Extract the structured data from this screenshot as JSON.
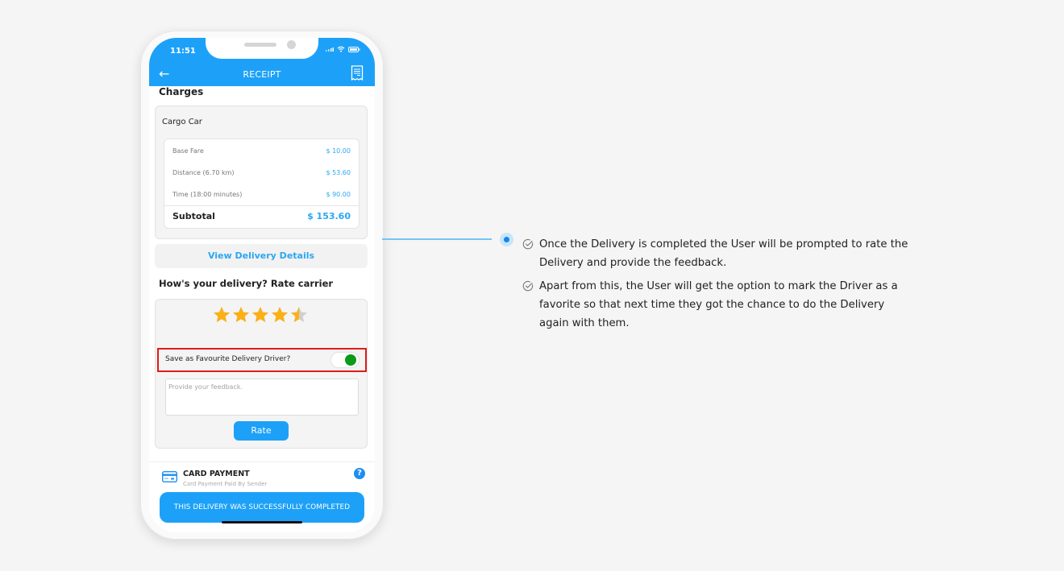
{
  "status_bar": {
    "time": "11:51"
  },
  "header": {
    "title": "RECEIPT",
    "back_icon": "arrow-left-icon",
    "receipt_icon": "receipt-icon"
  },
  "charges": {
    "heading": "Charges",
    "vehicle": "Cargo Car",
    "rows": [
      {
        "label": "Base Fare",
        "value": "$ 10.00"
      },
      {
        "label": "Distance (6.70 km)",
        "value": "$ 53.60"
      },
      {
        "label": "Time (18:00 minutes)",
        "value": "$ 90.00"
      }
    ],
    "subtotal_label": "Subtotal",
    "subtotal_value": "$ 153.60"
  },
  "view_details_label": "View Delivery Details",
  "rating": {
    "heading": "How's your delivery? Rate carrier",
    "stars_value": 4.5,
    "stars_max": 5,
    "favourite_label": "Save as Favourite Delivery Driver?",
    "favourite_on": true,
    "feedback_placeholder": "Provide your feedback.",
    "rate_button": "Rate"
  },
  "payment": {
    "title": "CARD PAYMENT",
    "subtitle": "Card Payment Paid By Sender",
    "help_icon": "?"
  },
  "status_message": "THIS DELIVERY WAS SUCCESSFULLY COMPLETED",
  "colors": {
    "primary": "#1da1f8",
    "toggle_on": "#0c9a1a",
    "highlight": "#e01b1b",
    "star": "#fbb016"
  },
  "annotation": {
    "notes": [
      "Once the Delivery is completed the User will be prompted to rate the Delivery and provide the feedback.",
      "Apart from this, the User will get the option to mark the Driver as a favorite so that next time they got the chance to do the Delivery again with them."
    ]
  }
}
